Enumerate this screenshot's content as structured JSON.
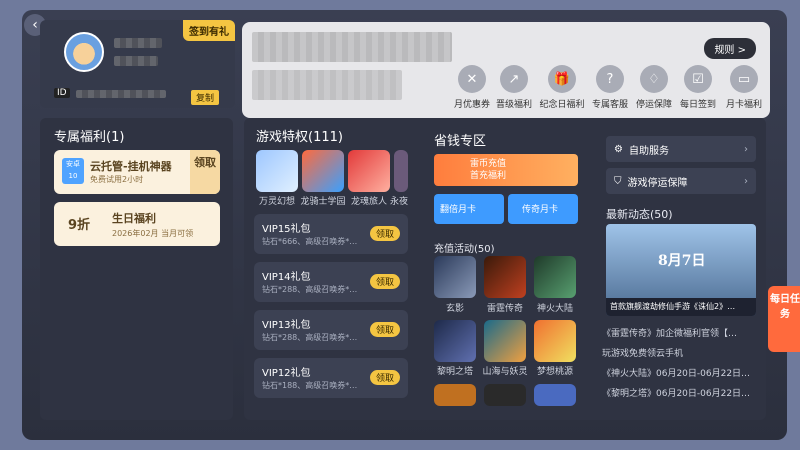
{
  "profile": {
    "signin": "签到有礼",
    "id": "ID",
    "copy": "复制"
  },
  "banner": {
    "rules": "规则 >",
    "items": [
      {
        "label": "月优惠券",
        "icon": "ticket-icon",
        "glyph": "✕"
      },
      {
        "label": "晋级福利",
        "icon": "upgrade-icon",
        "glyph": "↗"
      },
      {
        "label": "纪念日福利",
        "icon": "gift-icon",
        "glyph": "🎁"
      },
      {
        "label": "专属客服",
        "icon": "question-icon",
        "glyph": "?"
      },
      {
        "label": "停运保障",
        "icon": "shield-icon",
        "glyph": "♢"
      },
      {
        "label": "每日签到",
        "icon": "calendar-icon",
        "glyph": "☑"
      },
      {
        "label": "月卡福利",
        "icon": "card-icon",
        "glyph": "▭"
      }
    ]
  },
  "exclusive": {
    "title": "专属福利(1)",
    "coupon1": {
      "badge": "安卓",
      "badge_num": "10",
      "title": "云托管-挂机神器",
      "sub": "免费试用2小时",
      "get": "领取"
    },
    "coupon2": {
      "discount": "9折",
      "title": "生日福利",
      "sub": "2026年02月 当月可领"
    }
  },
  "game": {
    "title": "游戏特权(111)",
    "thumbs": [
      "万灵幻想",
      "龙骑士学园",
      "龙魂旅人",
      "永夜"
    ],
    "vip": [
      {
        "t": "VIP15礼包",
        "s": "钻石*666、高级召唤券*…",
        "b": "领取"
      },
      {
        "t": "VIP14礼包",
        "s": "钻石*288、高级召唤券*…",
        "b": "领取"
      },
      {
        "t": "VIP13礼包",
        "s": "钻石*288、高级召唤券*…",
        "b": "领取"
      },
      {
        "t": "VIP12礼包",
        "s": "钻石*188、高级召唤券*…",
        "b": "领取"
      }
    ]
  },
  "save": {
    "title": "省钱专区",
    "recharge1": "雷币充值",
    "recharge2": "首充福利",
    "double": "翻倍月卡",
    "legend": "传奇月卡",
    "activity": "充值活动(50)",
    "games": [
      "玄影",
      "雷霆传奇",
      "神火大陆",
      "黎明之塔",
      "山海与妖灵",
      "梦想桃源"
    ]
  },
  "right": {
    "self": "自助服务",
    "stop": "游戏停运保障",
    "news_title": "最新动态(50)",
    "news_caption": "首款旗舰渡劫修仙手游《诛仙2》…",
    "news_overlay": "8月7日",
    "news": [
      "《雷霆传奇》加企微福利官领【…",
      "玩游戏免费领云手机",
      "《神火大陆》06月20日-06月22日…",
      "《黎明之塔》06月20日-06月22日…"
    ]
  },
  "daily": "每日任务"
}
